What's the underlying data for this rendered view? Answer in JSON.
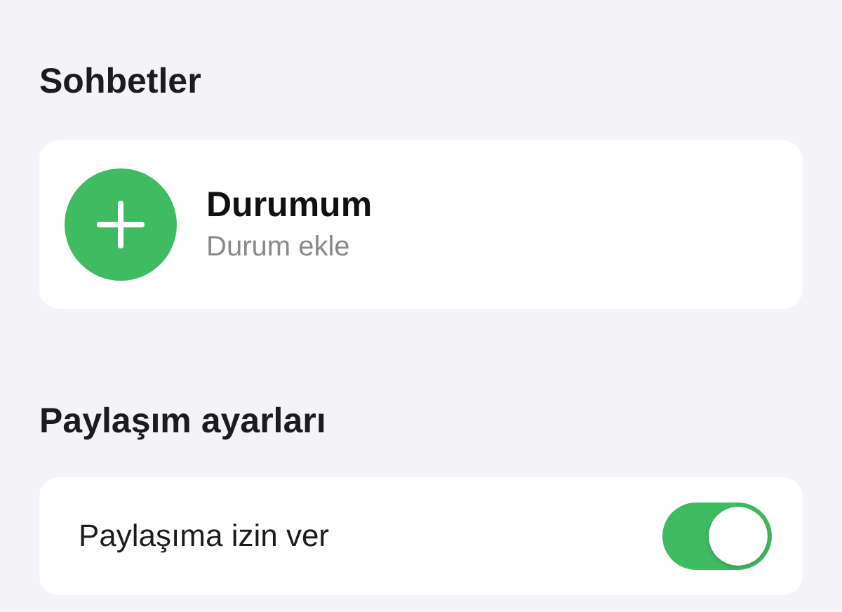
{
  "sections": [
    {
      "title": "Sohbetler",
      "kind": "status",
      "status": {
        "name": "Durumum",
        "subtitle": "Durum ekle"
      }
    },
    {
      "title": "Paylaşım ayarları",
      "kind": "toggle",
      "toggle": {
        "label": "Paylaşıma izin ver",
        "on": true
      }
    }
  ]
}
